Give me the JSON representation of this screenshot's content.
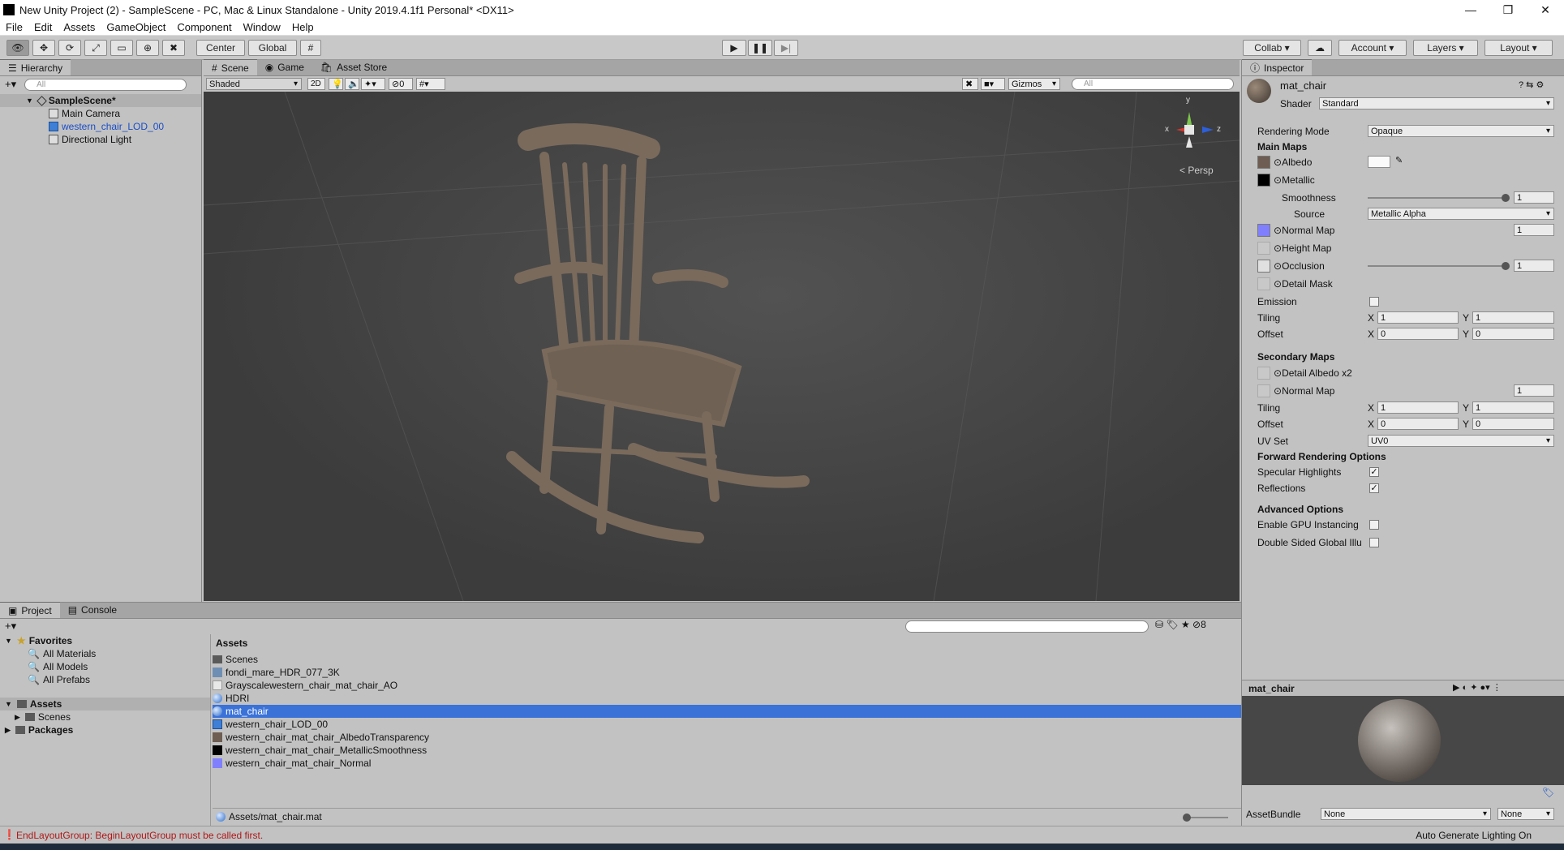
{
  "window": {
    "title": "New Unity Project (2) - SampleScene - PC, Mac & Linux Standalone - Unity 2019.4.1f1 Personal* <DX11>",
    "min": "—",
    "max": "❐",
    "close": "✕"
  },
  "menu": [
    "File",
    "Edit",
    "Assets",
    "GameObject",
    "Component",
    "Window",
    "Help"
  ],
  "toolbar": {
    "center": "Center",
    "global": "Global",
    "collab": "Collab",
    "account": "Account",
    "layers": "Layers",
    "layout": "Layout"
  },
  "hierarchy": {
    "tab": "Hierarchy",
    "search_placeholder": "All",
    "scene": "SampleScene*",
    "items": [
      "Main Camera",
      "western_chair_LOD_00",
      "Directional Light"
    ]
  },
  "scene": {
    "tabs": [
      "Scene",
      "Game",
      "Asset Store"
    ],
    "shading": "Shaded",
    "mode2d": "2D",
    "hidden_count": "0",
    "gizmos": "Gizmos",
    "search_placeholder": "All",
    "persp": "< Persp",
    "axis": {
      "x": "x",
      "y": "y",
      "z": "z"
    }
  },
  "inspector": {
    "tab": "Inspector",
    "material_name": "mat_chair",
    "shader_label": "Shader",
    "shader_value": "Standard",
    "rendering_mode_label": "Rendering Mode",
    "rendering_mode_value": "Opaque",
    "main_maps": "Main Maps",
    "albedo": "Albedo",
    "metallic": "Metallic",
    "smoothness": "Smoothness",
    "smoothness_value": "1",
    "source": "Source",
    "source_value": "Metallic Alpha",
    "normal_map": "Normal Map",
    "normal_value": "1",
    "height_map": "Height Map",
    "occlusion": "Occlusion",
    "occlusion_value": "1",
    "detail_mask": "Detail Mask",
    "emission": "Emission",
    "tiling": "Tiling",
    "offset": "Offset",
    "x": "X",
    "y": "Y",
    "tiling_x": "1",
    "tiling_y": "1",
    "offset_x": "0",
    "offset_y": "0",
    "secondary_maps": "Secondary Maps",
    "detail_albedo": "Detail Albedo x2",
    "sec_normal_map": "Normal Map",
    "sec_normal_value": "1",
    "sec_tiling_x": "1",
    "sec_tiling_y": "1",
    "sec_offset_x": "0",
    "sec_offset_y": "0",
    "uv_set": "UV Set",
    "uv_set_value": "UV0",
    "forward_options": "Forward Rendering Options",
    "specular_highlights": "Specular Highlights",
    "reflections": "Reflections",
    "advanced_options": "Advanced Options",
    "gpu_instancing": "Enable GPU Instancing",
    "double_sided": "Double Sided Global Illu",
    "preview_title": "mat_chair",
    "assetbundle": "AssetBundle",
    "assetbundle_value": "None",
    "assetbundle_variant": "None",
    "check_mark": "✓"
  },
  "project": {
    "tabs": [
      "Project",
      "Console"
    ],
    "favorites": "Favorites",
    "fav_items": [
      "All Materials",
      "All Models",
      "All Prefabs"
    ],
    "assets_root": "Assets",
    "scenes": "Scenes",
    "packages": "Packages",
    "breadcrumb": "Assets",
    "hidden_count": "8",
    "asset_list": [
      "Scenes",
      "fondi_mare_HDR_077_3K",
      "Grayscalewestern_chair_mat_chair_AO",
      "HDRI",
      "mat_chair",
      "western_chair_LOD_00",
      "western_chair_mat_chair_AlbedoTransparency",
      "western_chair_mat_chair_MetallicSmoothness",
      "western_chair_mat_chair_Normal"
    ],
    "selected_path": "Assets/mat_chair.mat"
  },
  "status": {
    "error": "EndLayoutGroup: BeginLayoutGroup must be called first.",
    "right": "Auto Generate Lighting On"
  }
}
